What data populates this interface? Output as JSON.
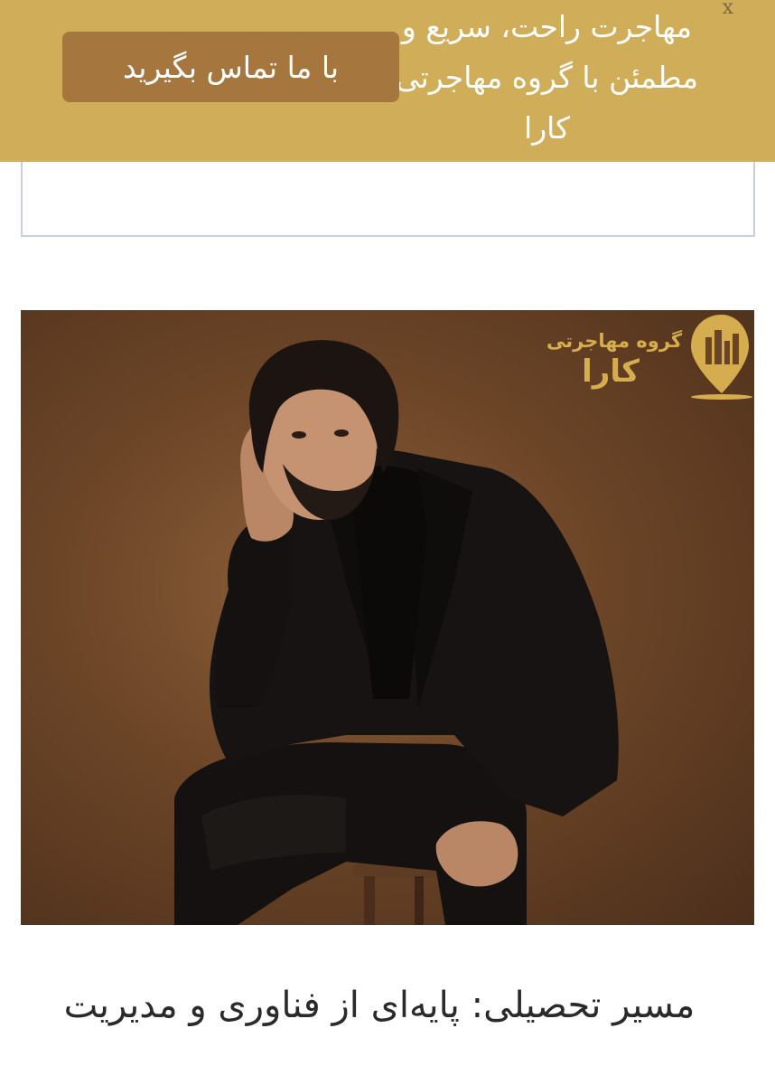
{
  "promo_banner": {
    "message": "مهاجرت راحت، سریع و مطمئن با گروه مهاجرتی کارا",
    "button_label": "با ما تماس بگیرید",
    "close_label": "x",
    "background_color": "#d0ad58",
    "button_color": "#a5763d"
  },
  "hero": {
    "logo_top_text": "گروه مهاجرتی",
    "logo_name": "کارا",
    "logo_icon": "city-pin-icon",
    "brand_color": "#d6ad4e"
  },
  "article": {
    "title": "مسیر تحصیلی: پایه‌ای از فناوری و مدیریت"
  }
}
